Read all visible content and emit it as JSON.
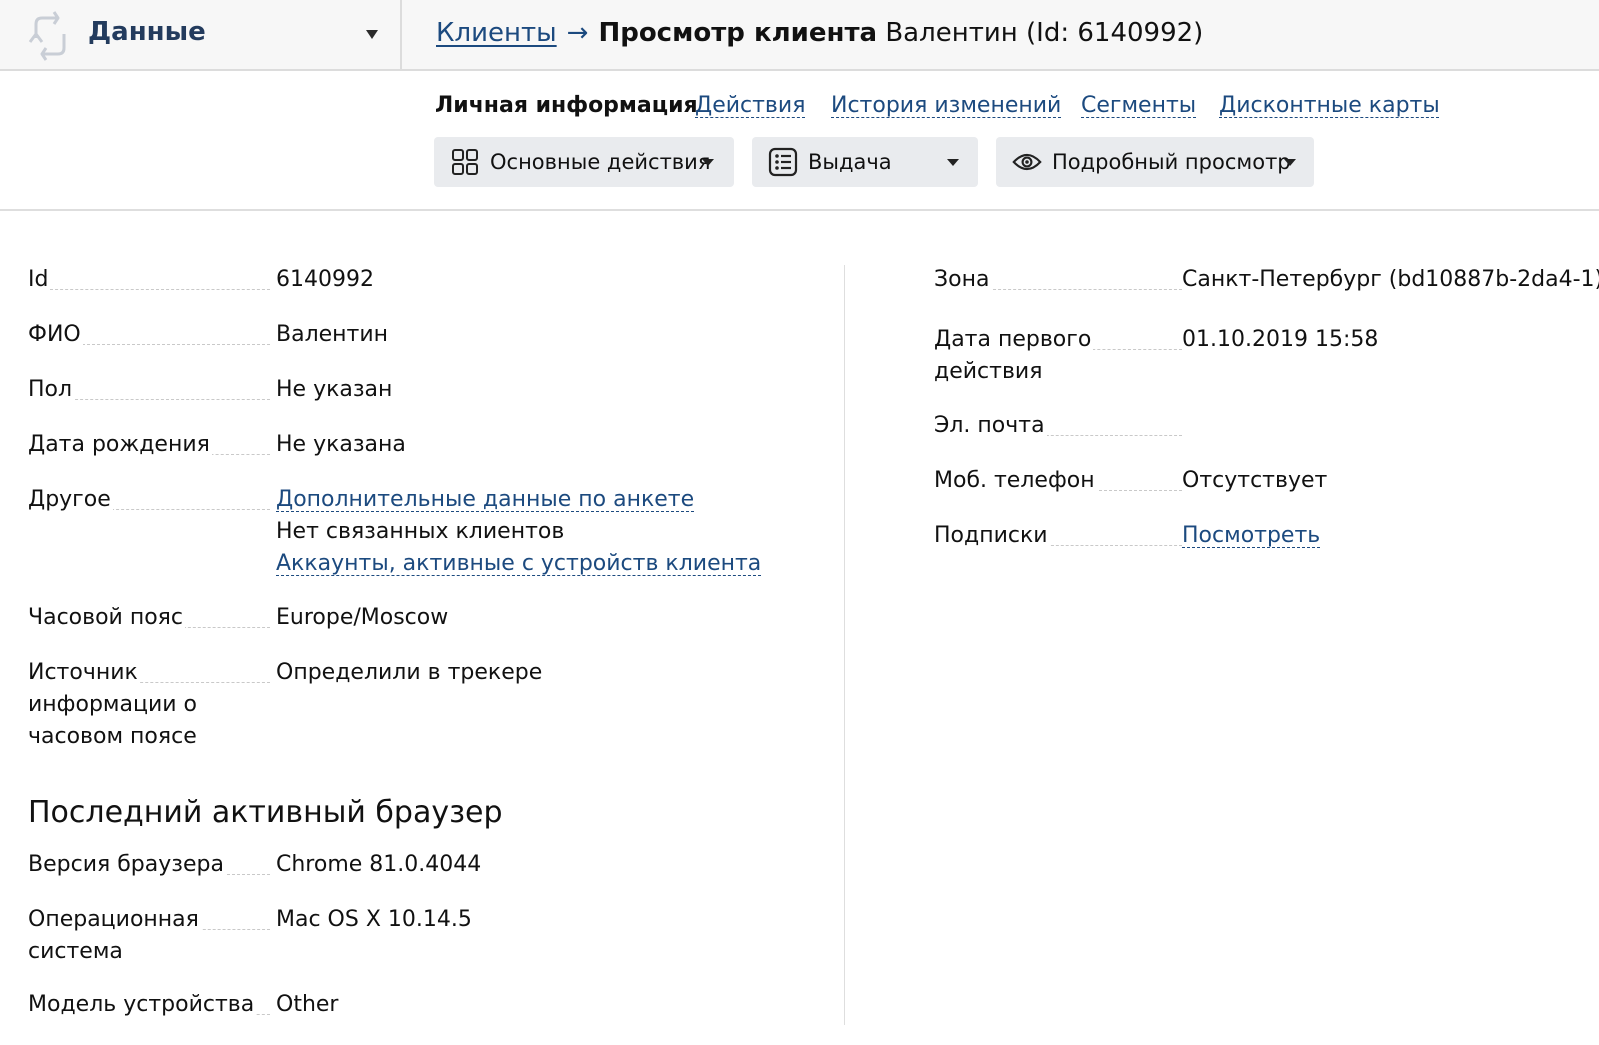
{
  "header": {
    "section_title": "Данные",
    "breadcrumb": {
      "link": "Клиенты",
      "arrow": "→",
      "title": "Просмотр клиента",
      "subtitle": "Валентин (Id: 6140992)"
    }
  },
  "tabs": [
    {
      "label": "Личная информация",
      "active": true
    },
    {
      "label": "Действия",
      "active": false
    },
    {
      "label": "История изменений",
      "active": false
    },
    {
      "label": "Сегменты",
      "active": false
    },
    {
      "label": "Дисконтные карты",
      "active": false
    }
  ],
  "toolbar": {
    "main_actions": {
      "label": "Основные действия",
      "icon": "grid-icon"
    },
    "issue": {
      "label": "Выдача",
      "icon": "list-icon"
    },
    "detailed_view": {
      "label": "Подробный просмотр",
      "icon": "eye-icon"
    }
  },
  "left_fields": {
    "id": {
      "label": "Id",
      "value": "6140992"
    },
    "fio": {
      "label": "ФИО",
      "value": "Валентин"
    },
    "gender": {
      "label": "Пол",
      "value": "Не указан"
    },
    "birthdate": {
      "label": "Дата рождения",
      "value": "Не указана"
    },
    "other": {
      "label": "Другое",
      "link1": "Дополнительные данные по анкете",
      "text": "Нет связанных клиентов",
      "link2": "Аккаунты, активные с устройств клиента"
    },
    "timezone": {
      "label": "Часовой пояс",
      "value": "Europe/Moscow"
    },
    "tz_source": {
      "label_lines": [
        "Источник",
        "информации о",
        "часовом поясе"
      ],
      "value": "Определили в трекере"
    }
  },
  "browser_section": {
    "heading": "Последний активный браузер",
    "browser_version": {
      "label": "Версия браузера",
      "value": "Chrome 81.0.4044"
    },
    "os": {
      "label_lines": [
        "Операционная",
        "система"
      ],
      "value": "Mac OS X 10.14.5"
    },
    "device_model": {
      "label": "Модель устройства",
      "value": "Other"
    }
  },
  "right_fields": {
    "zone": {
      "label": "Зона",
      "value": "Санкт-Петербург (bd10887b-2da4-1)"
    },
    "first_action": {
      "label_lines": [
        "Дата первого",
        "действия"
      ],
      "value": "01.10.2019 15:58"
    },
    "email": {
      "label": "Эл. почта",
      "value": ""
    },
    "mobile": {
      "label": "Моб. телефон",
      "value": "Отсутствует"
    },
    "subscriptions": {
      "label": "Подписки",
      "value": "Посмотреть"
    }
  },
  "colors": {
    "link": "#1c4a7f",
    "brand_title": "#233b5d",
    "button_bg": "#e9ebee",
    "header_bg": "#f7f7f7"
  }
}
